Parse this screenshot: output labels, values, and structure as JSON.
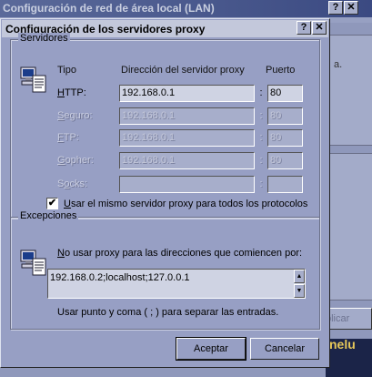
{
  "background_window": {
    "title": "Configuración de red de área local (LAN)",
    "help_glyph": "?",
    "close_glyph": "✕",
    "side_text": "a.",
    "button_label": "plicar",
    "thumb_text": "nelu"
  },
  "dialog": {
    "title": "Configuración de los servidores proxy",
    "help_glyph": "?",
    "close_glyph": "✕"
  },
  "servers": {
    "group_label": "Servidores",
    "col_type": "Tipo",
    "col_address": "Dirección del servidor proxy",
    "col_port": "Puerto",
    "colon": ":",
    "rows": [
      {
        "label": "HTTP:",
        "address": "192.168.0.1",
        "port": "80",
        "enabled": true
      },
      {
        "label": "Seguro:",
        "address": "192.168.0.1",
        "port": "80",
        "enabled": false
      },
      {
        "label": "FTP:",
        "address": "192.168.0.1",
        "port": "80",
        "enabled": false
      },
      {
        "label": "Gopher:",
        "address": "192.168.0.1",
        "port": "80",
        "enabled": false
      },
      {
        "label": "Socks:",
        "address": "",
        "port": "",
        "enabled": false
      }
    ],
    "use_same_label": "Usar el mismo servidor proxy para todos los protocolos",
    "use_same_checked": true,
    "check_glyph": "✔"
  },
  "exceptions": {
    "group_label": "Excepciones",
    "description": "No usar proxy para las direcciones que comiencen por:",
    "value": "192.168.0.2;localhost;127.0.0.1",
    "hint": "Usar punto y coma ( ; ) para separar las entradas.",
    "scroll_up": "▲",
    "scroll_down": "▼"
  },
  "buttons": {
    "ok": "Aceptar",
    "cancel": "Cancelar"
  },
  "colors": {
    "dialog_bg": "#979fc4",
    "titlebar_active": "#c3c8db",
    "titlebar_inactive": "#3b4a82"
  }
}
